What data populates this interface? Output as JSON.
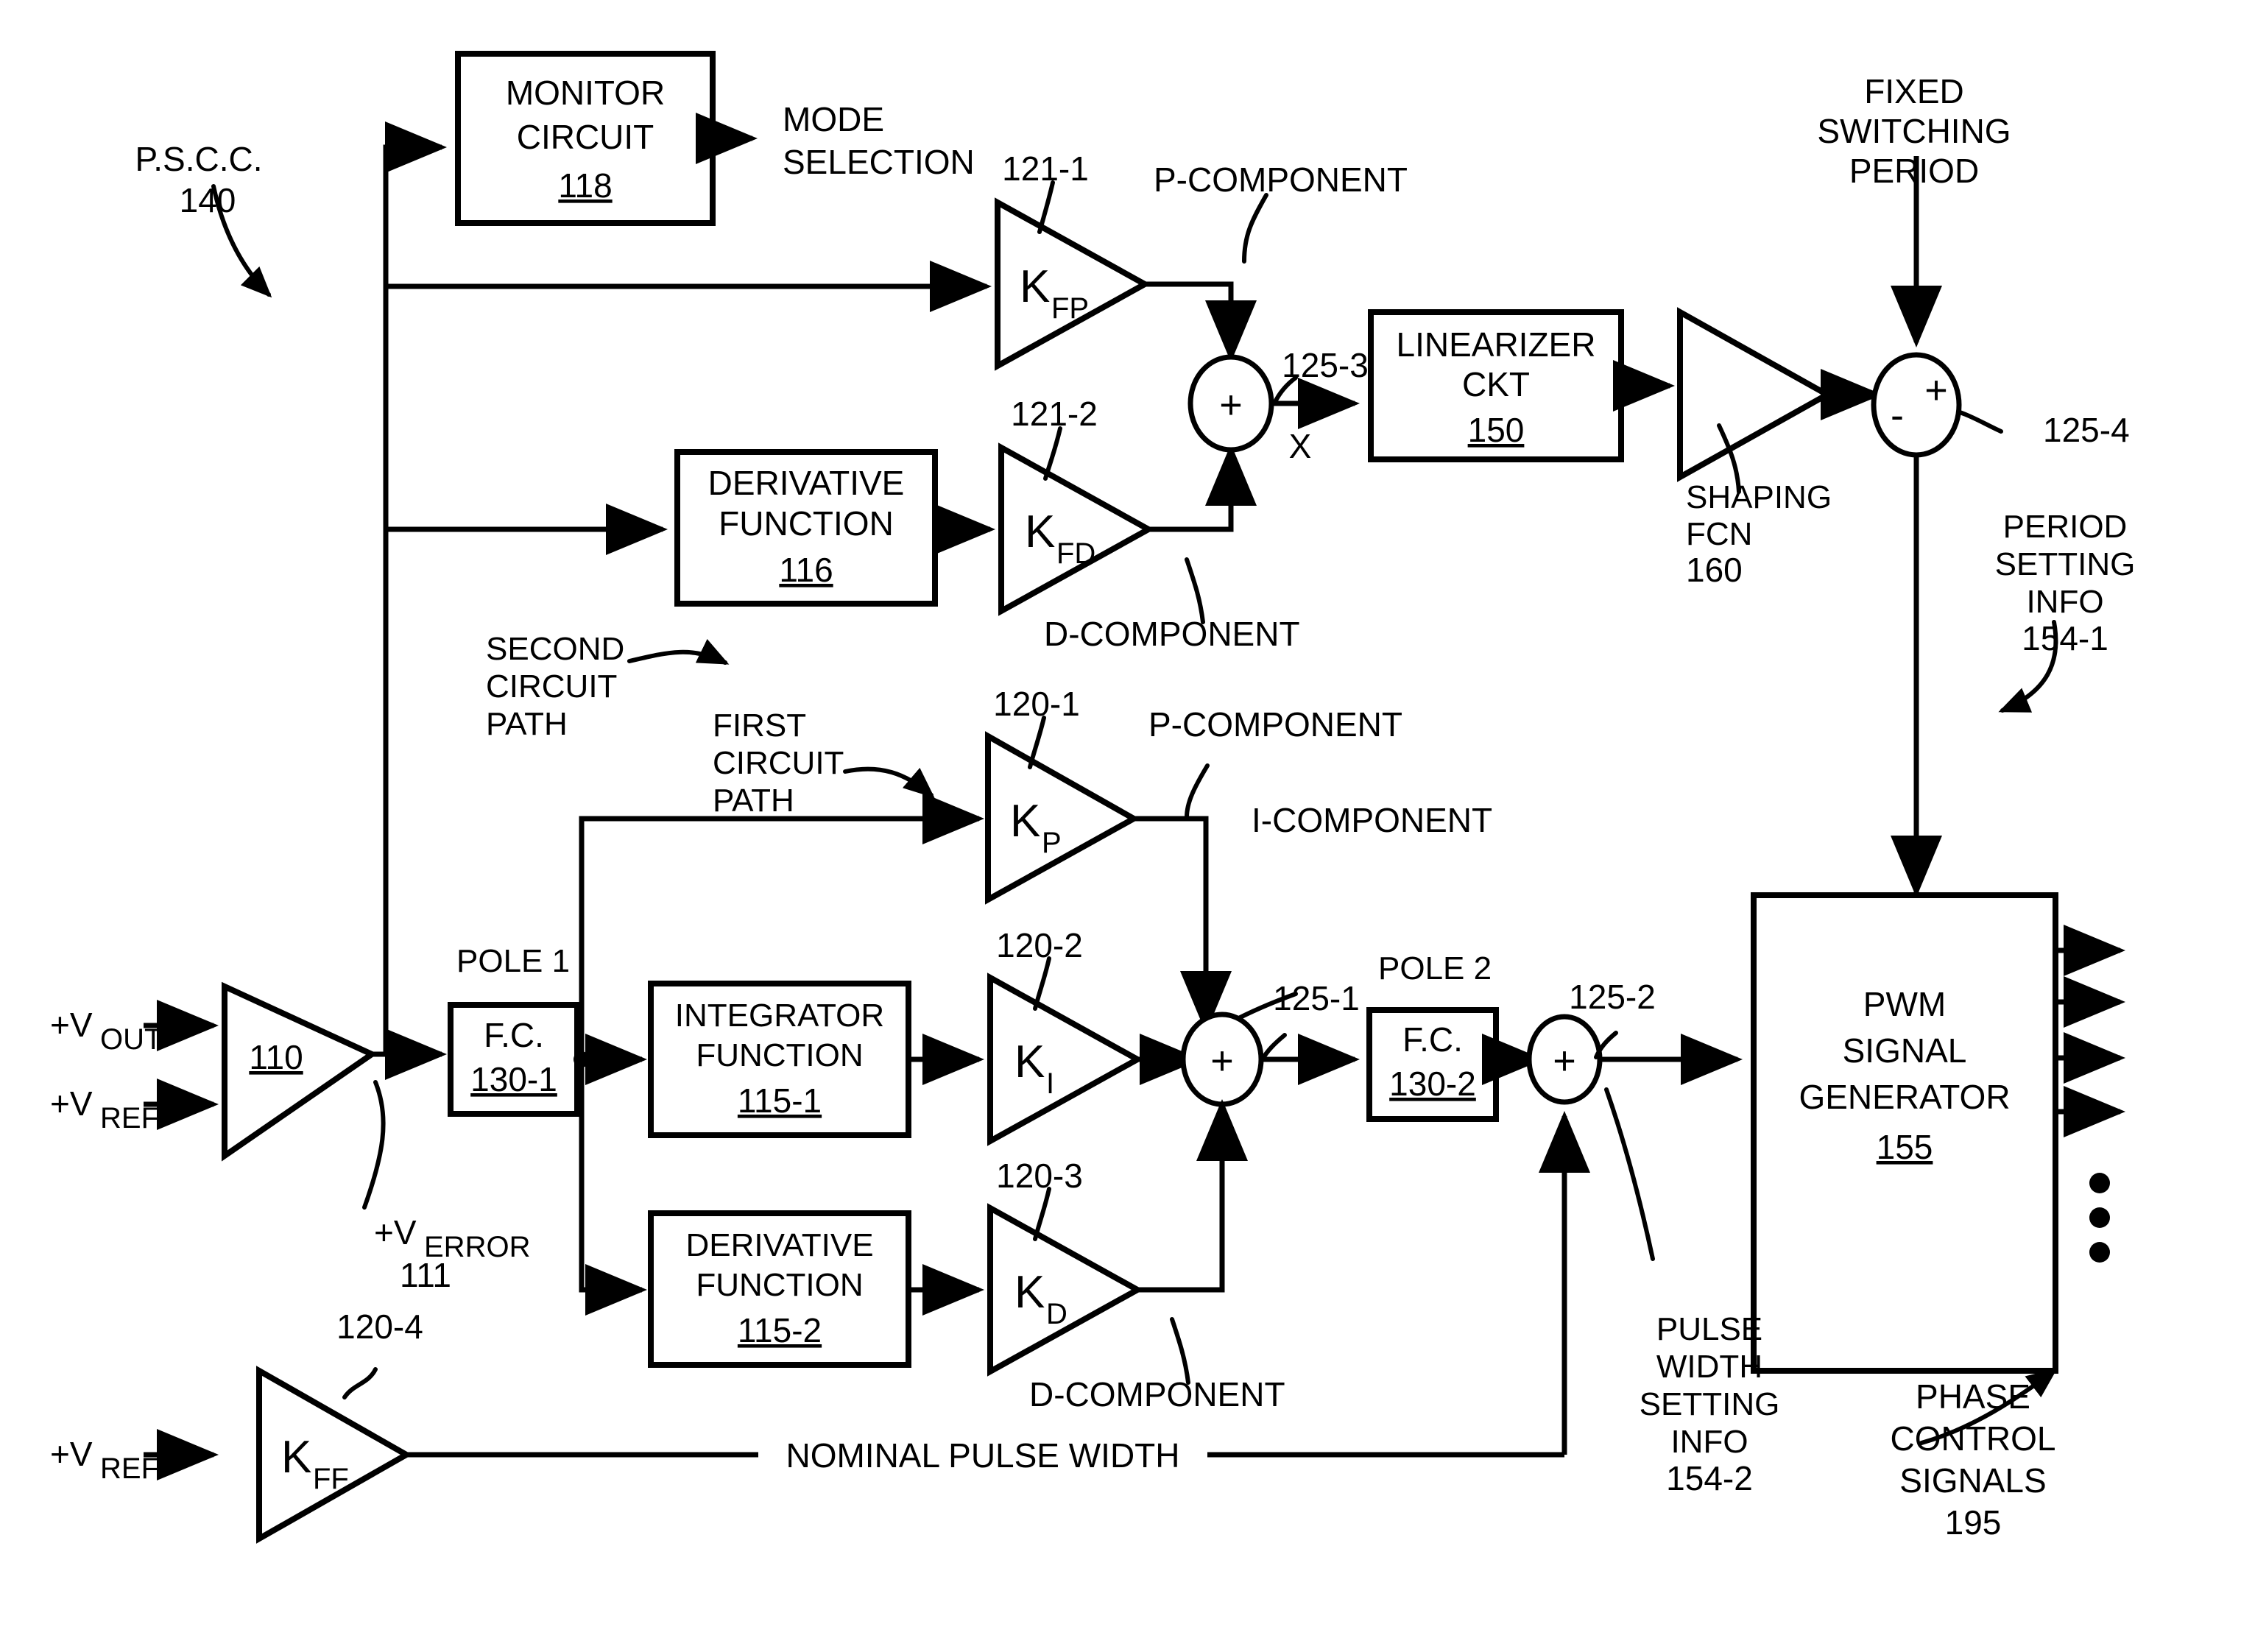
{
  "diagram": {
    "title": "Power supply control circuit block diagram",
    "labels": {
      "pscc_name": "P.S.C.C.",
      "pscc_num": "140",
      "monitor_l1": "MONITOR",
      "monitor_l2": "CIRCUIT",
      "monitor_num": "118",
      "mode_l1": "MODE",
      "mode_l2": "SELECTION",
      "kfp": "K",
      "kfp_sub": "FP",
      "ref_121_1": "121-1",
      "p_component_top": "P-COMPONENT",
      "deriv116_l1": "DERIVATIVE",
      "deriv116_l2": "FUNCTION",
      "deriv116_num": "116",
      "kfd": "K",
      "kfd_sub": "FD",
      "ref_121_2": "121-2",
      "d_component_top": "D-COMPONENT",
      "node_125_3": "125-3",
      "node_125_3_sign": "+",
      "x_label": "X",
      "linearizer_l1": "LINEARIZER",
      "linearizer_l2": "CKT",
      "linearizer_num": "150",
      "shaping_l1": "SHAPING",
      "shaping_l2": "FCN",
      "shaping_num": "160",
      "fixed_l1": "FIXED",
      "fixed_l2": "SWITCHING",
      "fixed_l3": "PERIOD",
      "node_125_4": "125-4",
      "node_125_4_plus": "+",
      "node_125_4_minus": "-",
      "period_l1": "PERIOD",
      "period_l2": "SETTING",
      "period_l3": "INFO",
      "period_num": "154-1",
      "second_path_l1": "SECOND",
      "second_path_l2": "CIRCUIT",
      "second_path_l3": "PATH",
      "first_path_l1": "FIRST",
      "first_path_l2": "CIRCUIT",
      "first_path_l3": "PATH",
      "ref_120_1": "120-1",
      "kp": "K",
      "kp_sub": "P",
      "p_component_bot": "P-COMPONENT",
      "i_component": "I-COMPONENT",
      "vout": "+V",
      "vout_sub": "OUT",
      "vref1": "+V",
      "vref1_sub": "REF",
      "amp110_num": "110",
      "pole1": "POLE 1",
      "fc1_l1": "F.C.",
      "fc1_num": "130-1",
      "verror": "+V",
      "verror_sub": "ERROR",
      "verror_num": "111",
      "integ_l1": "INTEGRATOR",
      "integ_l2": "FUNCTION",
      "integ_num": "115-1",
      "ref_120_2": "120-2",
      "ki": "K",
      "ki_sub": "I",
      "node_125_1": "125-1",
      "node_125_1_sign": "+",
      "pole2": "POLE 2",
      "fc2_l1": "F.C.",
      "fc2_num": "130-2",
      "node_125_2": "125-2",
      "node_125_2_sign": "+",
      "pwm_l1": "PWM",
      "pwm_l2": "SIGNAL",
      "pwm_l3": "GENERATOR",
      "pwm_num": "155",
      "deriv115_l1": "DERIVATIVE",
      "deriv115_l2": "FUNCTION",
      "deriv115_num": "115-2",
      "ref_120_3": "120-3",
      "kd": "K",
      "kd_sub": "D",
      "d_component_bot": "D-COMPONENT",
      "ref_120_4": "120-4",
      "vref2": "+V",
      "vref2_sub": "REF",
      "kff": "K",
      "kff_sub": "FF",
      "nominal_pw": "NOMINAL PULSE WIDTH",
      "pulse_l1": "PULSE",
      "pulse_l2": "WIDTH",
      "pulse_l3": "SETTING",
      "pulse_l4": "INFO",
      "pulse_num": "154-2",
      "phase_l1": "PHASE",
      "phase_l2": "CONTROL",
      "phase_l3": "SIGNALS",
      "phase_num": "195"
    },
    "colors": {
      "ink": "#000000",
      "paper": "#ffffff"
    }
  }
}
